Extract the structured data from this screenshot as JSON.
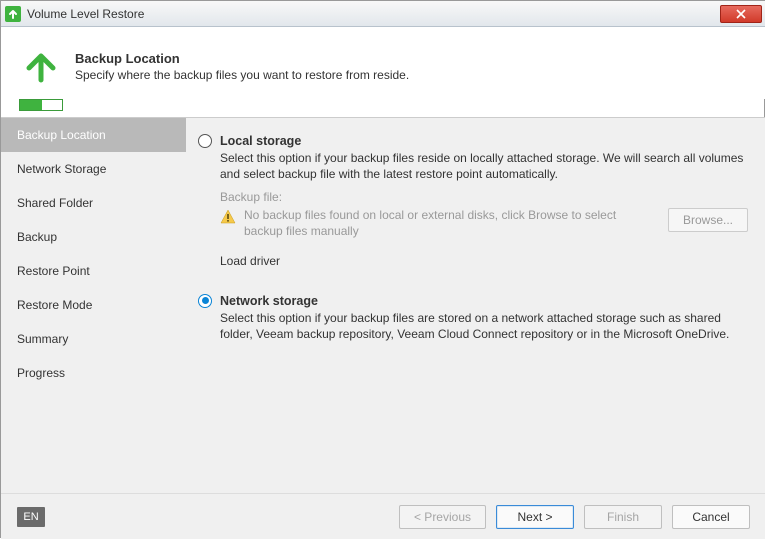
{
  "window": {
    "title": "Volume Level Restore"
  },
  "header": {
    "title": "Backup Location",
    "subtitle": "Specify where the backup files you want to restore from reside."
  },
  "sidebar": {
    "items": [
      {
        "label": "Backup Location",
        "selected": true
      },
      {
        "label": "Network Storage",
        "selected": false
      },
      {
        "label": "Shared Folder",
        "selected": false
      },
      {
        "label": "Backup",
        "selected": false
      },
      {
        "label": "Restore Point",
        "selected": false
      },
      {
        "label": "Restore Mode",
        "selected": false
      },
      {
        "label": "Summary",
        "selected": false
      },
      {
        "label": "Progress",
        "selected": false
      }
    ]
  },
  "options": {
    "local": {
      "title": "Local storage",
      "desc": "Select this option if your backup files reside on locally attached storage. We will search all volumes and select backup file with the latest restore point automatically.",
      "backup_file_label": "Backup file:",
      "warning": "No backup files found on local or external disks, click Browse to select backup files manually",
      "browse_label": "Browse...",
      "load_driver_label": "Load driver",
      "selected": false
    },
    "network": {
      "title": "Network storage",
      "desc": "Select this option if your backup files are stored on a network attached storage such as shared folder, Veeam backup repository, Veeam Cloud Connect repository or in the Microsoft OneDrive.",
      "selected": true
    }
  },
  "footer": {
    "lang": "EN",
    "previous": "< Previous",
    "next": "Next >",
    "finish": "Finish",
    "cancel": "Cancel"
  },
  "colors": {
    "accent": "#0a84d6",
    "green": "#3fb33f"
  }
}
